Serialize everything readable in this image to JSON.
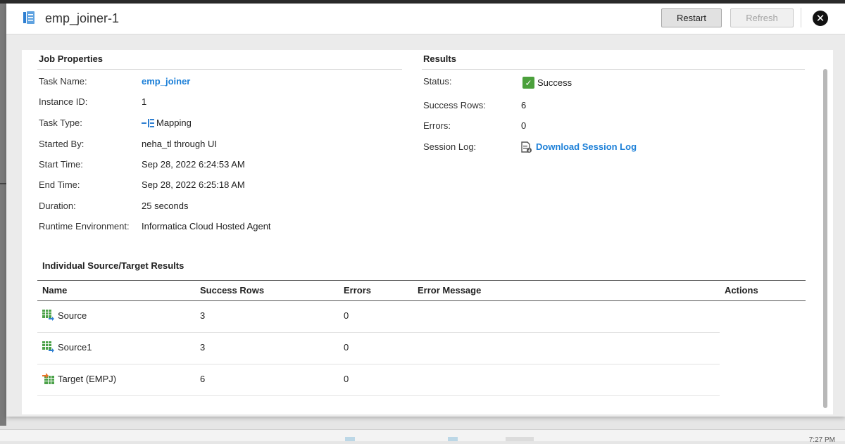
{
  "dialog": {
    "title": "emp_joiner-1",
    "restart_label": "Restart",
    "refresh_label": "Refresh",
    "close_symbol": "✕"
  },
  "job_properties": {
    "heading": "Job Properties",
    "fields": [
      {
        "label": "Task Name:",
        "value": "emp_joiner"
      },
      {
        "label": "Instance ID:",
        "value": "1"
      },
      {
        "label": "Task Type:",
        "value": "Mapping"
      },
      {
        "label": "Started By:",
        "value": "neha_tl through UI"
      },
      {
        "label": "Start Time:",
        "value": "Sep 28, 2022 6:24:53 AM"
      },
      {
        "label": "End Time:",
        "value": "Sep 28, 2022 6:25:18 AM"
      },
      {
        "label": "Duration:",
        "value": "25 seconds"
      },
      {
        "label": "Runtime Environment:",
        "value": "Informatica Cloud Hosted Agent"
      }
    ]
  },
  "results": {
    "heading": "Results",
    "fields": [
      {
        "label": "Status:",
        "value": "Success"
      },
      {
        "label": "Success Rows:",
        "value": "6"
      },
      {
        "label": "Errors:",
        "value": "0"
      },
      {
        "label": "Session Log:",
        "value": "Download Session Log"
      }
    ]
  },
  "individual_results": {
    "heading": "Individual Source/Target Results",
    "columns": [
      "Name",
      "Success Rows",
      "Errors",
      "Error Message",
      "Actions"
    ],
    "rows": [
      {
        "name": "Source",
        "success_rows": "3",
        "errors": "0",
        "error_message": "",
        "icon": "source-table-icon"
      },
      {
        "name": "Source1",
        "success_rows": "3",
        "errors": "0",
        "error_message": "",
        "icon": "source-table-icon"
      },
      {
        "name": "Target (EMPJ)",
        "success_rows": "6",
        "errors": "0",
        "error_message": "",
        "icon": "target-table-icon"
      }
    ]
  },
  "taskbar": {
    "clock": "7:27 PM"
  },
  "colors": {
    "link": "#1d80d8",
    "success": "#4ba03c"
  }
}
